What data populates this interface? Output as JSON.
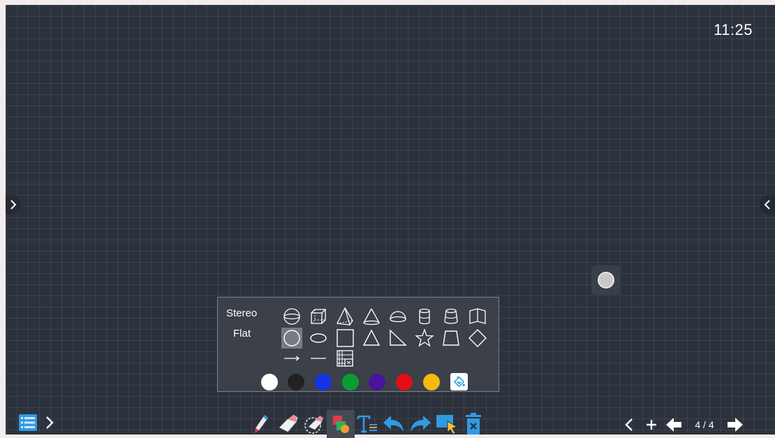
{
  "clock": "11:25",
  "shape_panel": {
    "stereo_label": "Stereo",
    "flat_label": "Flat",
    "stereo_shapes": [
      "sphere-icon",
      "cube-icon",
      "pyramid-icon",
      "cone-icon",
      "hemisphere-icon",
      "cylinder-icon",
      "frustum-icon",
      "prism-icon"
    ],
    "flat_shapes": [
      "circle-icon",
      "ellipse-icon",
      "square-icon",
      "triangle-icon",
      "right-triangle-icon",
      "star-icon",
      "trapezoid-icon",
      "diamond-icon"
    ],
    "line_shapes": [
      "arrow-line-icon",
      "straight-line-icon",
      "table-icon"
    ],
    "selected_shape": "circle-icon",
    "colors": [
      "#ffffff",
      "#222222",
      "#1434e6",
      "#0a9d32",
      "#4b129a",
      "#e30e16",
      "#f8b80d"
    ],
    "fill_icon": "paint-bucket-icon"
  },
  "toolbar": {
    "menu_icon": "menu-list-icon",
    "expand_icon": "chevron-right-icon",
    "tools": [
      "pen-icon",
      "eraser-icon",
      "area-eraser-icon",
      "shapes-icon",
      "text-icon",
      "undo-icon",
      "redo-icon",
      "select-icon",
      "clear-icon"
    ],
    "active_tool": "shapes-icon"
  },
  "page_nav": {
    "current_page": 4,
    "total_pages": 4,
    "label": "4 / 4"
  },
  "accent_color": "#2f9be0"
}
